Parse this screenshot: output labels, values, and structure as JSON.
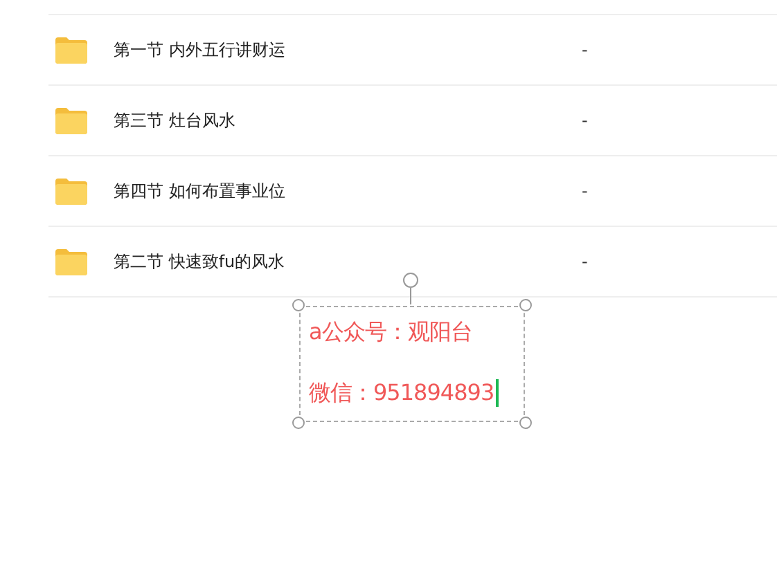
{
  "rows": [
    {
      "name": "第一节 内外五行讲财运",
      "column_2": "-"
    },
    {
      "name": "第三节 灶台风水",
      "column_2": "-"
    },
    {
      "name": "第四节 如何布置事业位",
      "column_2": "-"
    },
    {
      "name": "第二节 快速致fu的风水",
      "column_2": "-"
    }
  ],
  "text_box": {
    "lines": [
      "a公众号：观阳台",
      "微信：951894893"
    ],
    "color": "#f05858"
  }
}
